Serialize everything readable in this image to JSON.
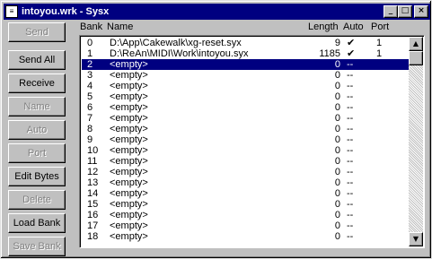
{
  "window": {
    "title": "intoyou.wrk - Sysx",
    "icon": "document-icon",
    "controls": {
      "minimize": "_",
      "maximize": "□",
      "close": "×"
    }
  },
  "buttons": [
    {
      "label": "Send",
      "enabled": false
    },
    {
      "label": "Send All",
      "enabled": true
    },
    {
      "label": "Receive",
      "enabled": true
    },
    {
      "label": "Name",
      "enabled": false
    },
    {
      "label": "Auto",
      "enabled": false
    },
    {
      "label": "Port",
      "enabled": false
    },
    {
      "label": "Edit Bytes",
      "enabled": true
    },
    {
      "label": "Delete",
      "enabled": false
    },
    {
      "label": "Load Bank",
      "enabled": true
    },
    {
      "label": "Save Bank",
      "enabled": false
    }
  ],
  "columns": {
    "bank": "Bank",
    "name": "Name",
    "length": "Length",
    "auto": "Auto",
    "port": "Port"
  },
  "rows": [
    {
      "bank": "0",
      "name": "D:\\App\\Cakewalk\\xg-reset.syx",
      "length": "9",
      "auto": "✔",
      "port": "1"
    },
    {
      "bank": "1",
      "name": "D:\\ReAn\\MIDI\\Work\\intoyou.syx",
      "length": "1185",
      "auto": "✔",
      "port": "1"
    },
    {
      "bank": "2",
      "name": "<empty>",
      "length": "0",
      "auto": "--",
      "port": ""
    },
    {
      "bank": "3",
      "name": "<empty>",
      "length": "0",
      "auto": "--",
      "port": ""
    },
    {
      "bank": "4",
      "name": "<empty>",
      "length": "0",
      "auto": "--",
      "port": ""
    },
    {
      "bank": "5",
      "name": "<empty>",
      "length": "0",
      "auto": "--",
      "port": ""
    },
    {
      "bank": "6",
      "name": "<empty>",
      "length": "0",
      "auto": "--",
      "port": ""
    },
    {
      "bank": "7",
      "name": "<empty>",
      "length": "0",
      "auto": "--",
      "port": ""
    },
    {
      "bank": "8",
      "name": "<empty>",
      "length": "0",
      "auto": "--",
      "port": ""
    },
    {
      "bank": "9",
      "name": "<empty>",
      "length": "0",
      "auto": "--",
      "port": ""
    },
    {
      "bank": "10",
      "name": "<empty>",
      "length": "0",
      "auto": "--",
      "port": ""
    },
    {
      "bank": "11",
      "name": "<empty>",
      "length": "0",
      "auto": "--",
      "port": ""
    },
    {
      "bank": "12",
      "name": "<empty>",
      "length": "0",
      "auto": "--",
      "port": ""
    },
    {
      "bank": "13",
      "name": "<empty>",
      "length": "0",
      "auto": "--",
      "port": ""
    },
    {
      "bank": "14",
      "name": "<empty>",
      "length": "0",
      "auto": "--",
      "port": ""
    },
    {
      "bank": "15",
      "name": "<empty>",
      "length": "0",
      "auto": "--",
      "port": ""
    },
    {
      "bank": "16",
      "name": "<empty>",
      "length": "0",
      "auto": "--",
      "port": ""
    },
    {
      "bank": "17",
      "name": "<empty>",
      "length": "0",
      "auto": "--",
      "port": ""
    },
    {
      "bank": "18",
      "name": "<empty>",
      "length": "0",
      "auto": "--",
      "port": ""
    }
  ],
  "selected_row": 2,
  "scrollbar": {
    "up": "▲",
    "down": "▼"
  },
  "colors": {
    "selection": "#000080",
    "titlebar": "#000080",
    "face": "#c0c0c0"
  }
}
